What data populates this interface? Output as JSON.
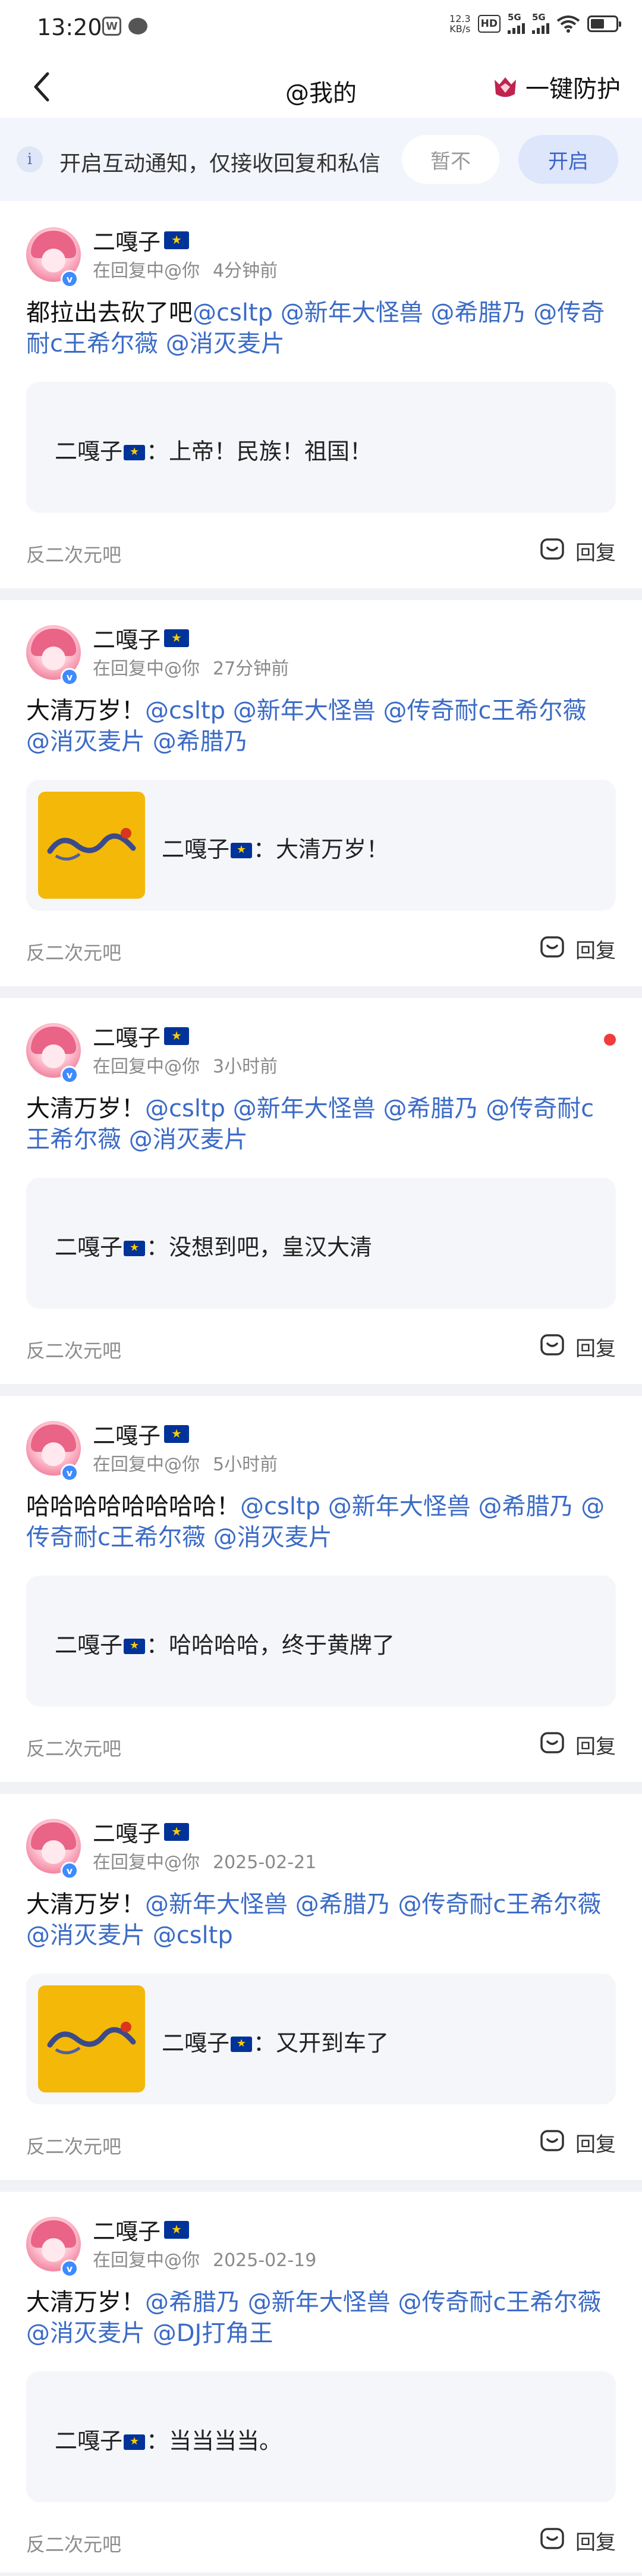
{
  "status": {
    "time": "13:20",
    "net_speed_top": "12.3",
    "net_speed_unit": "KB/s",
    "hd": "HD",
    "sim1": "5G",
    "sim2": "5G",
    "battery_level": 0.55
  },
  "header": {
    "back_icon": "chevron-left-icon",
    "title": "@我的",
    "protect_icon": "crown-shield-icon",
    "protect_label": "一键防护"
  },
  "banner": {
    "icon": "info-icon",
    "text": "开启互动通知，仅接收回复和私信",
    "later": "暂不",
    "open": "开启"
  },
  "posts": [
    {
      "user": "二嘎子",
      "meta_prefix": "在回复中@你",
      "time": "4分钟前",
      "unread": false,
      "content_lead": "都拉出去砍了吧",
      "mentions": [
        "@csltp",
        "@新年大怪兽",
        "@希腊乃",
        "@传奇耐c王希尔薇",
        "@消灭麦片"
      ],
      "quote_user": "二嘎子",
      "quote_text": "：上帝！民族！祖国！",
      "has_image": false,
      "source": "反二次元吧",
      "reply": "回复"
    },
    {
      "user": "二嘎子",
      "meta_prefix": "在回复中@你",
      "time": "27分钟前",
      "unread": false,
      "content_lead": "大清万岁！",
      "mentions": [
        "@csltp",
        "@新年大怪兽",
        "@传奇耐c王希尔薇",
        "@消灭麦片",
        "@希腊乃"
      ],
      "quote_user": "二嘎子",
      "quote_text": "：大清万岁！",
      "has_image": true,
      "source": "反二次元吧",
      "reply": "回复"
    },
    {
      "user": "二嘎子",
      "meta_prefix": "在回复中@你",
      "time": "3小时前",
      "unread": true,
      "content_lead": "大清万岁！",
      "mentions": [
        "@csltp",
        "@新年大怪兽",
        "@希腊乃",
        "@传奇耐c王希尔薇",
        "@消灭麦片"
      ],
      "quote_user": "二嘎子",
      "quote_text": "：没想到吧，皇汉大清",
      "has_image": false,
      "source": "反二次元吧",
      "reply": "回复"
    },
    {
      "user": "二嘎子",
      "meta_prefix": "在回复中@你",
      "time": "5小时前",
      "unread": false,
      "content_lead": "哈哈哈哈哈哈哈哈！",
      "mentions": [
        "@csltp",
        "@新年大怪兽",
        "@希腊乃",
        "@传奇耐c王希尔薇",
        "@消灭麦片"
      ],
      "quote_user": "二嘎子",
      "quote_text": "：哈哈哈哈，终于黄牌了",
      "has_image": false,
      "source": "反二次元吧",
      "reply": "回复"
    },
    {
      "user": "二嘎子",
      "meta_prefix": "在回复中@你",
      "time": "2025-02-21",
      "unread": false,
      "content_lead": "大清万岁！",
      "mentions": [
        "@新年大怪兽",
        "@希腊乃",
        "@传奇耐c王希尔薇",
        "@消灭麦片",
        "@csltp"
      ],
      "quote_user": "二嘎子",
      "quote_text": "：又开到车了",
      "has_image": true,
      "source": "反二次元吧",
      "reply": "回复"
    },
    {
      "user": "二嘎子",
      "meta_prefix": "在回复中@你",
      "time": "2025-02-19",
      "unread": false,
      "content_lead": "大清万岁！",
      "mentions": [
        "@希腊乃",
        "@新年大怪兽",
        "@传奇耐c王希尔薇",
        "@消灭麦片",
        "@DJ打角王"
      ],
      "quote_user": "二嘎子",
      "quote_text": "：当当当当。",
      "has_image": false,
      "source": "反二次元吧",
      "reply": "回复"
    }
  ]
}
